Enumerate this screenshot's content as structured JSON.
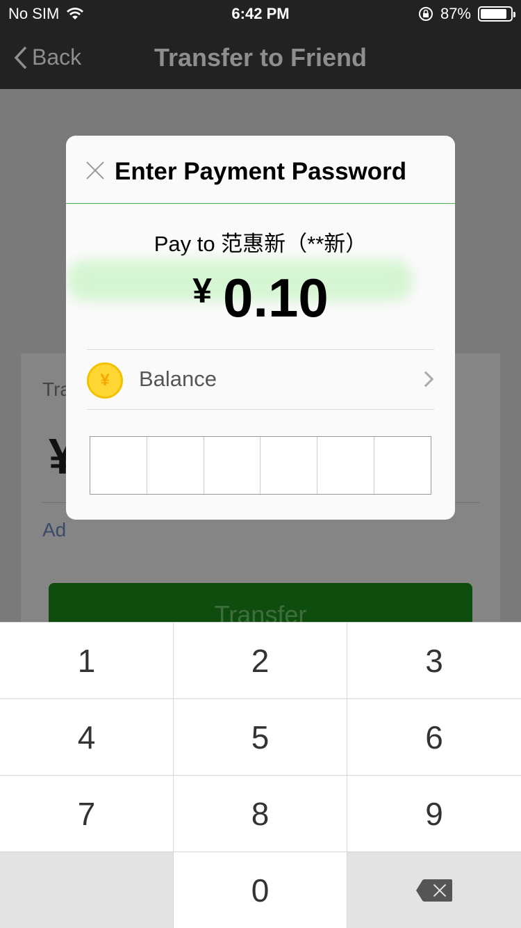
{
  "status_bar": {
    "carrier": "No SIM",
    "time": "6:42 PM",
    "battery_percent": "87%",
    "battery_level": 0.87
  },
  "nav": {
    "back_label": "Back",
    "title": "Transfer to Friend"
  },
  "background": {
    "transfer_label_partial": "Tra",
    "yen_partial": "¥",
    "add_partial": "Ad",
    "transfer_button": "Transfer"
  },
  "modal": {
    "title": "Enter Payment Password",
    "pay_to": "Pay to 范惠新（**新）",
    "currency_symbol": "¥",
    "amount": "0.10",
    "payment_method": {
      "icon_symbol": "¥",
      "label": "Balance"
    },
    "pin_length": 6
  },
  "keypad": {
    "keys": [
      "1",
      "2",
      "3",
      "4",
      "5",
      "6",
      "7",
      "8",
      "9",
      "",
      "0",
      "delete"
    ]
  }
}
